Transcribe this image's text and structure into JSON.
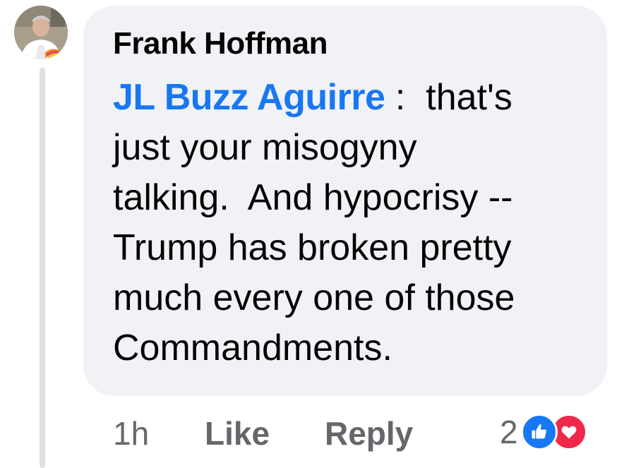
{
  "comment": {
    "author": "Frank Hoffman",
    "mention": "JL Buzz Aguirre",
    "separator": ":",
    "lines": [
      "that's",
      "just your misogyny",
      "talking.  And hypocrisy --",
      "Trump has broken pretty",
      "much every one of those",
      "Commandments."
    ]
  },
  "actions": {
    "time": "1h",
    "like_label": "Like",
    "reply_label": "Reply"
  },
  "reactions": {
    "count": "2",
    "icons": [
      "thumbs-up-icon",
      "heart-icon"
    ],
    "colors": {
      "like": "#1877f2",
      "love": "#f02849"
    }
  },
  "colors": {
    "mention": "#1877f2",
    "bubble": "#f0f2f5",
    "meta_text": "#65676b"
  }
}
